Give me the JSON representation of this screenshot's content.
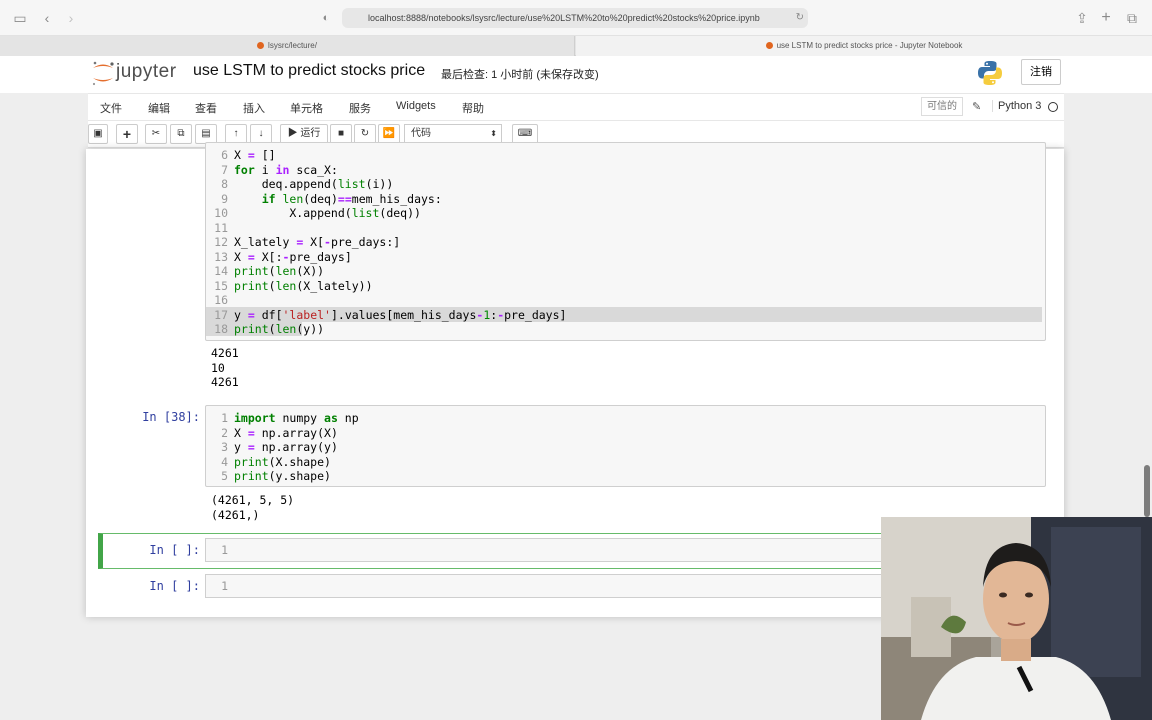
{
  "browser": {
    "url": "localhost:8888/notebooks/lsysrc/lecture/use%20LSTM%20to%20predict%20stocks%20price.ipynb",
    "tabs": [
      {
        "label": "lsysrc/lecture/"
      },
      {
        "label": "use LSTM to predict stocks price - Jupyter Notebook"
      }
    ]
  },
  "header": {
    "logo_text": "jupyter",
    "notebook_title": "use LSTM to predict stocks price",
    "checkpoint": "最后检查: 1 小时前  (未保存改变)",
    "logout_label": "注销"
  },
  "menubar": {
    "items": [
      "文件",
      "编辑",
      "查看",
      "插入",
      "单元格",
      "服务",
      "Widgets",
      "帮助"
    ],
    "trusted": "可信的",
    "kernel": "Python 3"
  },
  "toolbar": {
    "run_label": "运行",
    "cell_type": "代码"
  },
  "cells": {
    "cell1": {
      "lines": [
        {
          "n": "6",
          "code": "X = []"
        },
        {
          "n": "7",
          "code": "for i in sca_X:"
        },
        {
          "n": "8",
          "code": "    deq.append(list(i))"
        },
        {
          "n": "9",
          "code": "    if len(deq)==mem_his_days:"
        },
        {
          "n": "10",
          "code": "        X.append(list(deq))"
        },
        {
          "n": "11",
          "code": ""
        },
        {
          "n": "12",
          "code": "X_lately = X[-pre_days:]"
        },
        {
          "n": "13",
          "code": "X = X[:-pre_days]"
        },
        {
          "n": "14",
          "code": "print(len(X))"
        },
        {
          "n": "15",
          "code": "print(len(X_lately))"
        },
        {
          "n": "16",
          "code": ""
        },
        {
          "n": "17",
          "code": "y = df['label'].values[mem_his_days-1:-pre_days]"
        },
        {
          "n": "18",
          "code": "print(len(y))"
        }
      ],
      "output": "4261\n10\n4261"
    },
    "cell2": {
      "prompt": "In [38]:",
      "lines": [
        {
          "n": "1",
          "code": "import numpy as np"
        },
        {
          "n": "2",
          "code": "X = np.array(X)"
        },
        {
          "n": "3",
          "code": "y = np.array(y)"
        },
        {
          "n": "4",
          "code": "print(X.shape)"
        },
        {
          "n": "5",
          "code": "print(y.shape)"
        }
      ],
      "output": "(4261, 5, 5)\n(4261,)"
    },
    "cell3": {
      "prompt": "In [ ]:",
      "line": "1"
    },
    "cell4": {
      "prompt": "In [ ]:",
      "line": "1"
    }
  }
}
